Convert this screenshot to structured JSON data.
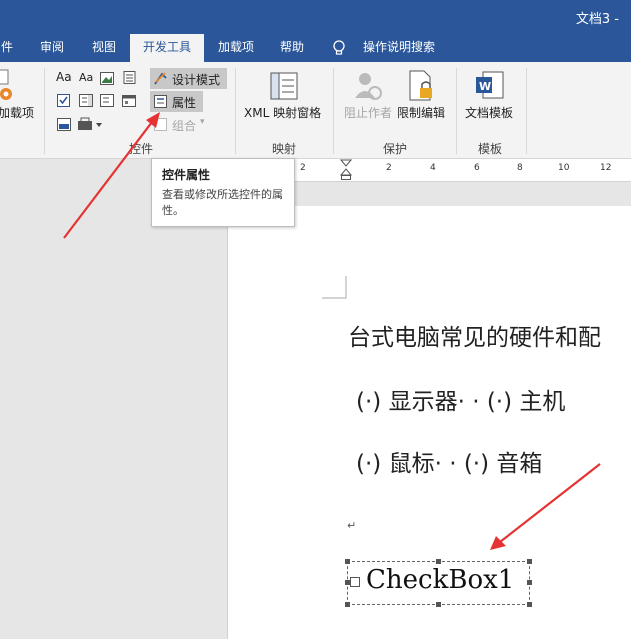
{
  "window": {
    "doc_title": "文档3 -"
  },
  "tabs": [
    {
      "label": "件"
    },
    {
      "label": "审阅"
    },
    {
      "label": "视图"
    },
    {
      "label": "开发工具"
    },
    {
      "label": "加载项"
    },
    {
      "label": "帮助"
    },
    {
      "label": "操作说明搜索"
    }
  ],
  "ribbon": {
    "addins_label": "加载项",
    "design_mode": "设计模式",
    "properties": "属性",
    "group_combine": "组合",
    "xml_map": "XML 映射窗格",
    "block_authors": "阻止作者",
    "restrict_edit": "限制编辑",
    "doc_template": "文档模板",
    "groups": {
      "controls": "控件",
      "mapping": "映射",
      "protect": "保护",
      "template": "模板"
    },
    "aa1": "Aa",
    "aa2": "Aa"
  },
  "tooltip": {
    "title": "控件属性",
    "description": "查看或修改所选控件的属性。"
  },
  "ruler": {
    "ticks": [
      "2",
      "2",
      "4",
      "6",
      "8",
      "10",
      "12"
    ]
  },
  "document": {
    "line1": "台式电脑常见的硬件和配",
    "line2": "(·) 显示器· · (·) 主机",
    "line3": "(·) 鼠标· · (·) 音箱",
    "return_mark": "↵",
    "checkbox_label": "CheckBox1"
  },
  "colors": {
    "accent": "#2b579a",
    "arrow": "#e53333"
  }
}
